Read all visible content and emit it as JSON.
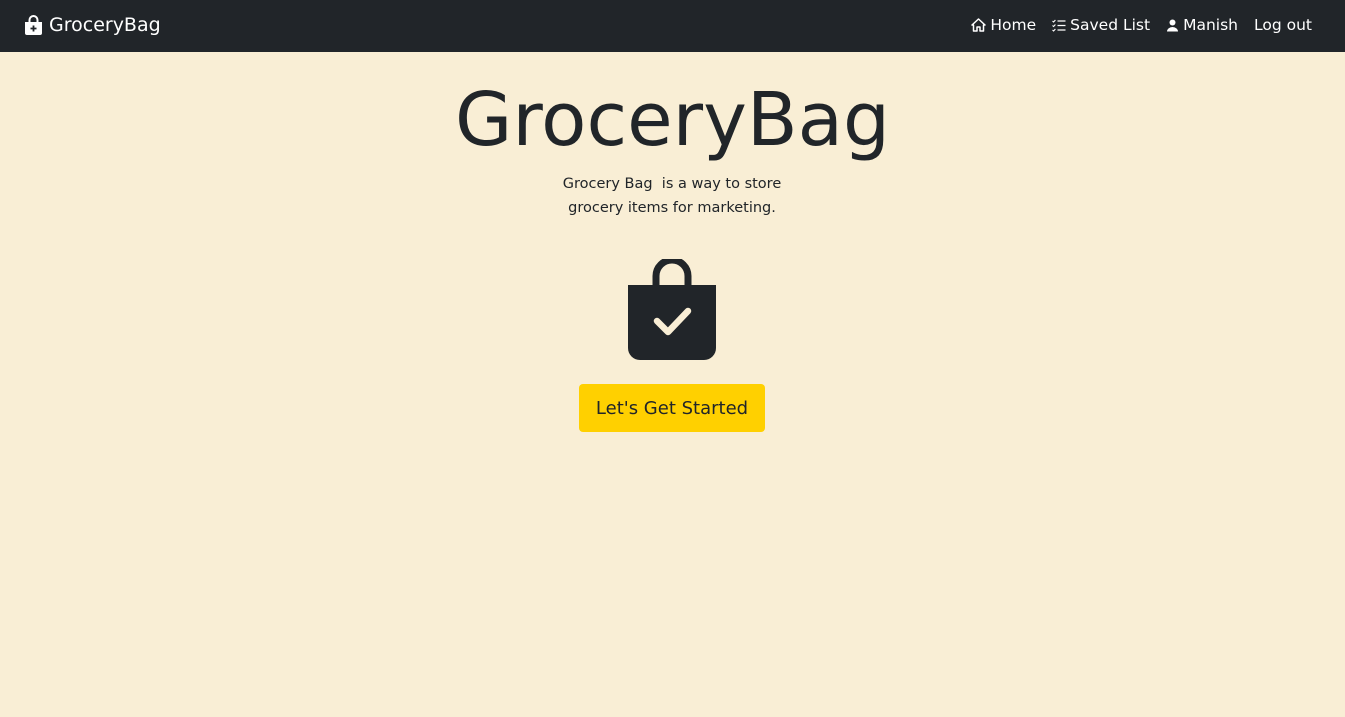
{
  "navbar": {
    "brand": "GroceryBag",
    "brand_icon": "bag-plus-icon",
    "links": [
      {
        "label": "Home",
        "icon": "house-icon"
      },
      {
        "label": "Saved List",
        "icon": "list-check-icon"
      },
      {
        "label": "Manish",
        "icon": "person-icon"
      },
      {
        "label": "Log out"
      }
    ]
  },
  "hero": {
    "title": "GroceryBag",
    "description_line1": "Grocery Bag  is a way to store",
    "description_line2": "grocery items for marketing.",
    "icon": "bag-check-icon",
    "cta_label": "Let's Get Started"
  },
  "colors": {
    "background": "#f9eed5",
    "navbar": "#212529",
    "accent": "#ffd000",
    "text": "#212529"
  }
}
